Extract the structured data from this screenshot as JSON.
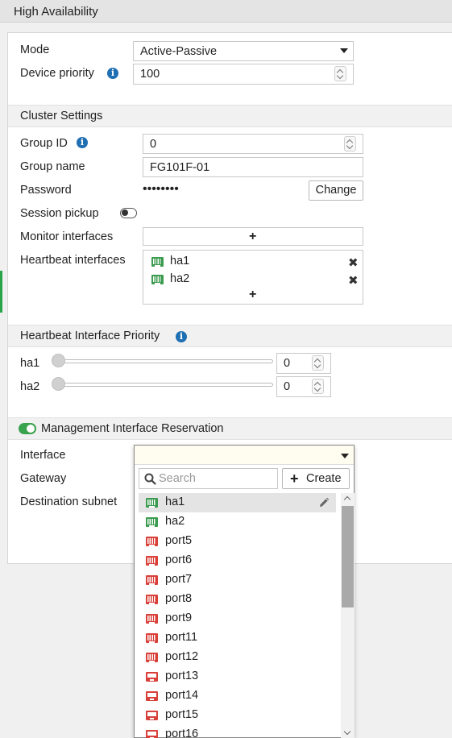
{
  "window": {
    "title": "High Availability"
  },
  "ha": {
    "mode_label": "Mode",
    "mode_value": "Active-Passive",
    "device_priority_label": "Device priority",
    "device_priority_value": "100"
  },
  "cluster": {
    "section_title": "Cluster Settings",
    "group_id_label": "Group ID",
    "group_id_value": "0",
    "group_name_label": "Group name",
    "group_name_value": "FG101F-01",
    "password_label": "Password",
    "password_mask": "••••••••",
    "change_button": "Change",
    "session_pickup_label": "Session pickup",
    "session_pickup_enabled": false,
    "monitor_interfaces_label": "Monitor interfaces",
    "add_symbol": "+",
    "heartbeat_interfaces_label": "Heartbeat interfaces",
    "heartbeat_interfaces": [
      {
        "name": "ha1",
        "remove_symbol": "✖"
      },
      {
        "name": "ha2",
        "remove_symbol": "✖"
      }
    ]
  },
  "heartbeat_priority": {
    "section_title": "Heartbeat Interface Priority",
    "rows": [
      {
        "name": "ha1",
        "value": "0"
      },
      {
        "name": "ha2",
        "value": "0"
      }
    ]
  },
  "mgmt": {
    "section_title": "Management Interface Reservation",
    "enabled": true,
    "interface_label": "Interface",
    "interface_value": "",
    "gateway_label": "Gateway",
    "destination_subnet_label": "Destination subnet"
  },
  "dropdown": {
    "search_placeholder": "Search",
    "create_label": "Create",
    "create_symbol": "+",
    "items": [
      {
        "name": "ha1",
        "icon": "green-port-icon",
        "selected": true
      },
      {
        "name": "ha2",
        "icon": "green-port-icon"
      },
      {
        "name": "port5",
        "icon": "red-port-icon"
      },
      {
        "name": "port6",
        "icon": "red-port-icon"
      },
      {
        "name": "port7",
        "icon": "red-port-icon"
      },
      {
        "name": "port8",
        "icon": "red-port-icon"
      },
      {
        "name": "port9",
        "icon": "red-port-icon"
      },
      {
        "name": "port11",
        "icon": "red-port-icon"
      },
      {
        "name": "port12",
        "icon": "red-port-icon"
      },
      {
        "name": "port13",
        "icon": "red-sfp-port-icon"
      },
      {
        "name": "port14",
        "icon": "red-sfp-port-icon"
      },
      {
        "name": "port15",
        "icon": "red-sfp-port-icon"
      },
      {
        "name": "port16",
        "icon": "red-sfp-port-icon"
      }
    ]
  },
  "colors": {
    "info_blue": "#1f6fb3",
    "port_up_green": "#3b9b4f",
    "port_down_red": "#d9403a",
    "toggle_on_green": "#3aa34e",
    "interface_field_bg": "#fffdf0"
  }
}
